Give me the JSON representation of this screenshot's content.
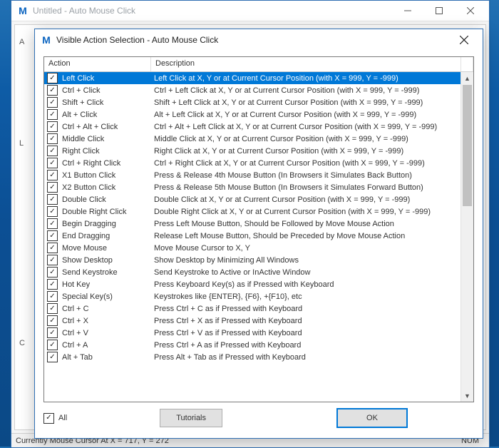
{
  "parent": {
    "title": "Untitled - Auto Mouse Click"
  },
  "dialog": {
    "title": "Visible Action Selection - Auto Mouse Click"
  },
  "columns": {
    "action": "Action",
    "description": "Description"
  },
  "selected_index": 0,
  "rows": [
    {
      "action": "Left Click",
      "desc": "Left Click at X, Y or at Current Cursor Position (with X = 999, Y = -999)"
    },
    {
      "action": "Ctrl + Click",
      "desc": "Ctrl + Left Click at X, Y or at Current Cursor Position (with X = 999, Y = -999)"
    },
    {
      "action": "Shift + Click",
      "desc": "Shift + Left Click at X, Y or at Current Cursor Position (with X = 999, Y = -999)"
    },
    {
      "action": "Alt + Click",
      "desc": "Alt + Left Click at X, Y or at Current Cursor Position (with X = 999, Y = -999)"
    },
    {
      "action": "Ctrl + Alt + Click",
      "desc": "Ctrl + Alt + Left Click at X, Y or at Current Cursor Position (with X = 999, Y = -999)"
    },
    {
      "action": "Middle Click",
      "desc": "Middle Click at X, Y or at Current Cursor Position (with X = 999, Y = -999)"
    },
    {
      "action": "Right Click",
      "desc": "Right Click at X, Y or at Current Cursor Position (with X = 999, Y = -999)"
    },
    {
      "action": "Ctrl + Right Click",
      "desc": "Ctrl + Right Click at X, Y or at Current Cursor Position (with X = 999, Y = -999)"
    },
    {
      "action": "X1 Button Click",
      "desc": "Press & Release 4th Mouse Button (In Browsers it Simulates Back Button)"
    },
    {
      "action": "X2 Button Click",
      "desc": "Press & Release 5th Mouse Button (In Browsers it Simulates Forward Button)"
    },
    {
      "action": "Double Click",
      "desc": "Double Click at X, Y or at Current Cursor Position (with X = 999, Y = -999)"
    },
    {
      "action": "Double Right Click",
      "desc": "Double Right Click at X, Y or at Current Cursor Position (with X = 999, Y = -999)"
    },
    {
      "action": "Begin Dragging",
      "desc": "Press Left Mouse Button, Should be Followed by Move Mouse Action"
    },
    {
      "action": "End Dragging",
      "desc": "Release Left Mouse Button, Should be Preceded by Move Mouse Action"
    },
    {
      "action": "Move Mouse",
      "desc": "Move Mouse Cursor to X, Y"
    },
    {
      "action": "Show Desktop",
      "desc": "Show Desktop by Minimizing All Windows"
    },
    {
      "action": "Send Keystroke",
      "desc": "Send Keystroke to Active or InActive Window"
    },
    {
      "action": "Hot Key",
      "desc": "Press Keyboard Key(s) as if Pressed with Keyboard"
    },
    {
      "action": "Special Key(s)",
      "desc": "Keystrokes like {ENTER}, {F6}, +{F10}, etc"
    },
    {
      "action": "Ctrl + C",
      "desc": "Press Ctrl + C as if Pressed with Keyboard"
    },
    {
      "action": "Ctrl + X",
      "desc": "Press Ctrl + X as if Pressed with Keyboard"
    },
    {
      "action": "Ctrl + V",
      "desc": "Press Ctrl + V as if Pressed with Keyboard"
    },
    {
      "action": "Ctrl + A",
      "desc": "Press Ctrl + A as if Pressed with Keyboard"
    },
    {
      "action": "Alt + Tab",
      "desc": "Press Alt + Tab as if Pressed with Keyboard"
    }
  ],
  "footer": {
    "all_label": "All",
    "tutorials_label": "Tutorials",
    "ok_label": "OK"
  },
  "statusbar": {
    "cursor": "Currently Mouse Cursor At X = 717, Y = 272",
    "num": "NUM"
  }
}
